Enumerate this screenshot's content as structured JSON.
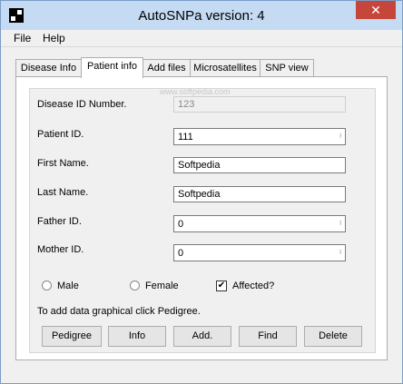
{
  "window": {
    "title": "AutoSNPa version: 4",
    "close_glyph": "✕"
  },
  "menu": [
    "File",
    "Help"
  ],
  "tabs": [
    "Disease Info",
    "Patient info",
    "Add files",
    "Microsatellites",
    "SNP view"
  ],
  "active_tab": "Patient info",
  "watermark": "www.softpedia.com",
  "form": {
    "disease_id": {
      "label": "Disease ID Number.",
      "value": "123",
      "disabled": true
    },
    "patient_id": {
      "label": "Patient ID.",
      "value": "111"
    },
    "first_name": {
      "label": "First Name.",
      "value": "Softpedia"
    },
    "last_name": {
      "label": "Last Name.",
      "value": "Softpedia"
    },
    "father_id": {
      "label": "Father ID.",
      "value": "0"
    },
    "mother_id": {
      "label": "Mother ID.",
      "value": "0"
    },
    "combo_arrow": "▲▼"
  },
  "options": {
    "male": {
      "label": "Male",
      "checked": false
    },
    "female": {
      "label": "Female",
      "checked": false
    },
    "affected": {
      "label": "Affected?",
      "checked": true,
      "mark": "✔"
    }
  },
  "hint": "To add data graphical click Pedigree.",
  "buttons": [
    "Pedigree",
    "Info",
    "Add.",
    "Find",
    "Delete"
  ]
}
